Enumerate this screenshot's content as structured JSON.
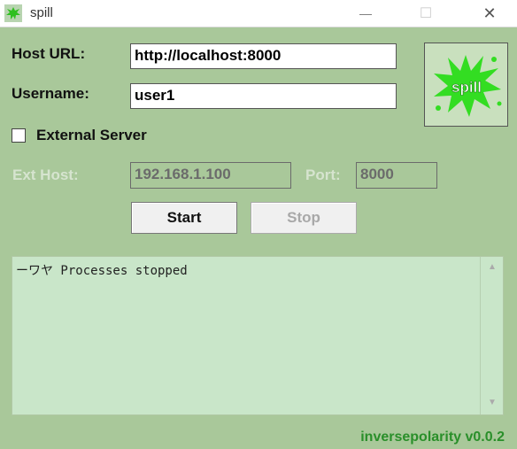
{
  "window": {
    "title": "spill",
    "minimize_glyph": "—",
    "maximize_glyph": "☐",
    "close_glyph": "✕"
  },
  "form": {
    "host_url_label": "Host URL:",
    "host_url_value": "http://localhost:8000",
    "username_label": "Username:",
    "username_value": "user1",
    "external_server_label": "External Server",
    "external_server_checked": false,
    "ext_host_label": "Ext Host:",
    "ext_host_value": "192.168.1.100",
    "port_label": "Port:",
    "port_value": "8000"
  },
  "buttons": {
    "start_label": "Start",
    "stop_label": "Stop"
  },
  "logo": {
    "text": "spill",
    "icon": "green-splat-icon"
  },
  "log": {
    "text": "ーワヤ Processes stopped"
  },
  "footer": {
    "version": "inversepolarity v0.0.2"
  },
  "colors": {
    "window_bg": "#a9c89a",
    "log_bg": "#c9e6c9",
    "version_text": "#2a8f2a",
    "splat": "#33dd22"
  }
}
